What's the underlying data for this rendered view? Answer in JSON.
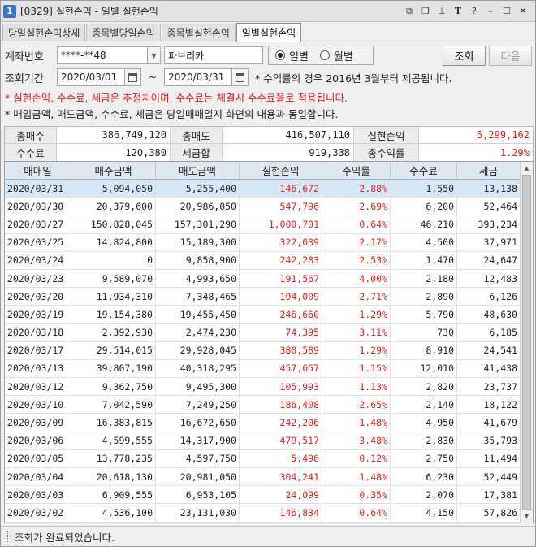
{
  "window": {
    "number": "1",
    "title": "[0329] 실현손익 - 일별 실현손익"
  },
  "tabs": [
    {
      "label": "당일실현손익상세"
    },
    {
      "label": "종목별당일손익"
    },
    {
      "label": "종목별실현손익"
    },
    {
      "label": "일별실현손익",
      "active": true
    }
  ],
  "form": {
    "account_label": "계좌번호",
    "account_value": "****-**48",
    "account_name": "파브리카",
    "mode_daily": "일별",
    "mode_monthly": "월별",
    "selected_mode": "일별",
    "period_label": "조회기간",
    "date_from": "2020/03/01",
    "date_to": "2020/03/31",
    "tilde": "~",
    "rate_note": "* 수익률의 경우 2016년 3월부터 제공됩니다.",
    "search_button": "조회",
    "next_button": "다음"
  },
  "notices": {
    "warning": "* 실현손익, 수수료, 세금은 추정치이며, 수수료는 체결시 수수료율로 적용됩니다.",
    "info": "* 매입금액, 매도금액, 수수료, 세금은 당일매매일지 화면의 내용과 동일합니다."
  },
  "summary": {
    "total_buy_label": "총매수",
    "total_buy": "386,749,120",
    "total_sell_label": "총매도",
    "total_sell": "416,507,110",
    "realized_label": "실현손익",
    "realized": "5,299,162",
    "fee_label": "수수료",
    "fee": "120,380",
    "tax_label": "세금합",
    "tax": "919,338",
    "return_label": "총수익률",
    "return": "1.29%"
  },
  "grid": {
    "columns": [
      "매매일",
      "매수금액",
      "매도금액",
      "실현손익",
      "수익률",
      "수수료",
      "세금"
    ],
    "rows": [
      [
        "2020/03/31",
        "5,094,050",
        "5,255,400",
        "146,672",
        "2.88%",
        "1,550",
        "13,138"
      ],
      [
        "2020/03/30",
        "20,379,600",
        "20,986,050",
        "547,796",
        "2.69%",
        "6,200",
        "52,464"
      ],
      [
        "2020/03/27",
        "150,828,045",
        "157,301,290",
        "1,000,701",
        "0.64%",
        "46,210",
        "393,234"
      ],
      [
        "2020/03/25",
        "14,824,800",
        "15,189,300",
        "322,039",
        "2.17%",
        "4,500",
        "37,971"
      ],
      [
        "2020/03/24",
        "0",
        "9,858,900",
        "242,283",
        "2.53%",
        "1,470",
        "24,647"
      ],
      [
        "2020/03/23",
        "9,589,070",
        "4,993,650",
        "191,567",
        "4.00%",
        "2,180",
        "12,483"
      ],
      [
        "2020/03/20",
        "11,934,310",
        "7,348,465",
        "194,009",
        "2.71%",
        "2,890",
        "6,126"
      ],
      [
        "2020/03/19",
        "19,154,380",
        "19,455,450",
        "246,660",
        "1.29%",
        "5,790",
        "48,630"
      ],
      [
        "2020/03/18",
        "2,392,930",
        "2,474,230",
        "74,395",
        "3.11%",
        "730",
        "6,185"
      ],
      [
        "2020/03/17",
        "29,514,015",
        "29,928,045",
        "380,589",
        "1.29%",
        "8,910",
        "24,541"
      ],
      [
        "2020/03/13",
        "39,807,190",
        "40,318,295",
        "457,657",
        "1.15%",
        "12,010",
        "41,438"
      ],
      [
        "2020/03/12",
        "9,362,750",
        "9,495,300",
        "105,993",
        "1.13%",
        "2,820",
        "23,737"
      ],
      [
        "2020/03/10",
        "7,042,590",
        "7,249,250",
        "186,408",
        "2.65%",
        "2,140",
        "18,122"
      ],
      [
        "2020/03/09",
        "16,383,815",
        "16,672,650",
        "242,206",
        "1.48%",
        "4,950",
        "41,679"
      ],
      [
        "2020/03/06",
        "4,599,555",
        "14,317,900",
        "479,517",
        "3.48%",
        "2,830",
        "35,793"
      ],
      [
        "2020/03/05",
        "13,778,235",
        "4,597,750",
        "5,496",
        "0.12%",
        "2,750",
        "11,494"
      ],
      [
        "2020/03/04",
        "20,618,130",
        "20,981,050",
        "304,241",
        "1.48%",
        "6,230",
        "52,449"
      ],
      [
        "2020/03/03",
        "6,909,555",
        "6,953,105",
        "24,099",
        "0.35%",
        "2,070",
        "17,381"
      ],
      [
        "2020/03/02",
        "4,536,100",
        "23,131,030",
        "146,834",
        "0.64%",
        "4,150",
        "57,826"
      ]
    ]
  },
  "status": {
    "message": "조회가 완료되었습니다."
  }
}
